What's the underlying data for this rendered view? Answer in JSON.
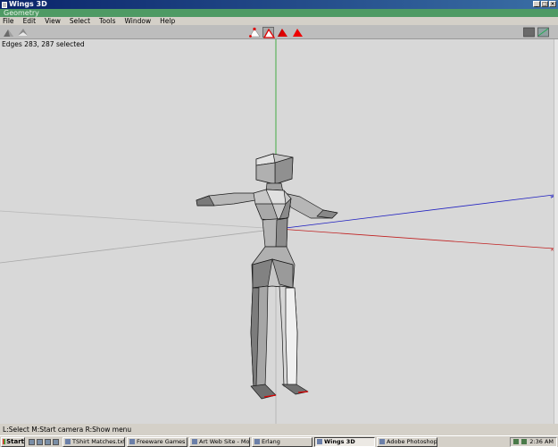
{
  "app": {
    "title": "Wings 3D"
  },
  "geometry_window": {
    "title": "Geometry"
  },
  "menu": [
    "File",
    "Edit",
    "View",
    "Select",
    "Tools",
    "Window",
    "Help"
  ],
  "status": {
    "selection": "Edges 283, 287 selected"
  },
  "info_line": "L:Select  M:Start camera  R:Show menu",
  "toolbar": {
    "left_tools": [
      "view-tool-icon",
      "front-view-icon"
    ],
    "mode_buttons": [
      "vertex-mode-icon",
      "edge-mode-icon",
      "face-mode-icon",
      "body-mode-icon"
    ],
    "active_mode": "edge-mode-icon",
    "right_tools": [
      "shaded-view-icon",
      "wireframe-toggle-icon"
    ]
  },
  "taskbar": {
    "start_label": "Start",
    "items": [
      {
        "label": "TShirt Matches.txt - ...",
        "active": false
      },
      {
        "label": "Freeware Games",
        "active": false
      },
      {
        "label": "Art Web Site - Mozilla",
        "active": false
      },
      {
        "label": "Erlang",
        "active": false
      },
      {
        "label": "Wings 3D",
        "active": true
      },
      {
        "label": "Adobe Photoshop",
        "active": false
      }
    ],
    "clock": "2:36 AM"
  },
  "colors": {
    "title_bar": "#0a246a",
    "geometry_title": "#4e9a64",
    "viewport_bg": "#d8d8d8",
    "axis_x": "#c02020",
    "axis_y": "#20a020",
    "axis_z": "#2020c0",
    "selected_edge": "#e00000"
  }
}
